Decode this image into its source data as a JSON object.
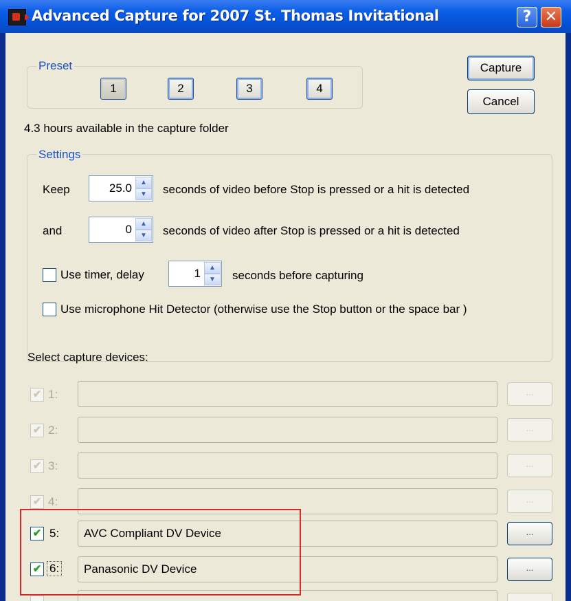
{
  "window": {
    "title": "Advanced Capture for 2007 St. Thomas Invitational",
    "help_glyph": "?",
    "close_glyph": "✕"
  },
  "preset": {
    "label": "Preset",
    "buttons": [
      "1",
      "2",
      "3",
      "4"
    ]
  },
  "actions": {
    "capture": "Capture",
    "cancel": "Cancel"
  },
  "hours_available": "4.3 hours available in the capture folder",
  "settings": {
    "label": "Settings",
    "keep_label": "Keep",
    "keep_value": "25.0",
    "keep_suffix": "seconds of video before Stop is pressed or a hit is detected",
    "and_label": "and",
    "after_value": "0",
    "after_suffix": "seconds of video after Stop is pressed or a hit is detected",
    "timer_label": "Use timer, delay",
    "timer_value": "1",
    "timer_suffix": "seconds before capturing",
    "hit_label": "Use microphone Hit Detector (otherwise use the Stop button or the space bar )"
  },
  "devices": {
    "label": "Select capture devices:",
    "browse_glyph": "...",
    "rows": [
      {
        "num": "1:",
        "value": "",
        "enabled": false,
        "checked": true
      },
      {
        "num": "2:",
        "value": "",
        "enabled": false,
        "checked": true
      },
      {
        "num": "3:",
        "value": "",
        "enabled": false,
        "checked": true
      },
      {
        "num": "4:",
        "value": "",
        "enabled": false,
        "checked": true
      },
      {
        "num": "5:",
        "value": "AVC Compliant DV Device",
        "enabled": true,
        "checked": true
      },
      {
        "num": "6:",
        "value": "Panasonic DV Device",
        "enabled": true,
        "checked": true
      }
    ]
  },
  "colors": {
    "title_bar": "#0b5ee8",
    "dialog_bg": "#ece9d8",
    "group_label": "#1a52c6",
    "highlight": "#d8292a",
    "check_mark": "#21a121"
  }
}
